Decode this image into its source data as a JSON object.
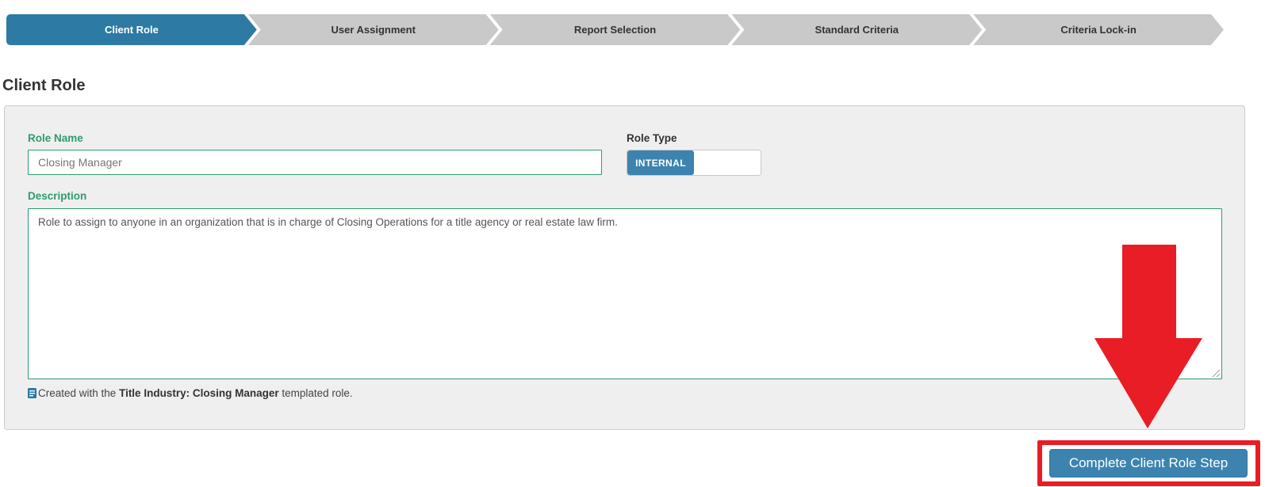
{
  "stepper": {
    "steps": [
      {
        "label": "Client Role",
        "active": true
      },
      {
        "label": "User Assignment",
        "active": false
      },
      {
        "label": "Report Selection",
        "active": false
      },
      {
        "label": "Standard Criteria",
        "active": false
      },
      {
        "label": "Criteria Lock-in",
        "active": false
      }
    ]
  },
  "page": {
    "title": "Client Role"
  },
  "form": {
    "role_name": {
      "label": "Role Name",
      "value": "Closing Manager"
    },
    "role_type": {
      "label": "Role Type",
      "selected": "INTERNAL"
    },
    "description": {
      "label": "Description",
      "value": "Role to assign to anyone in an organization that is in charge of Closing Operations for a title agency or real estate law firm."
    },
    "template_note": {
      "prefix": "Created with the ",
      "template_name": "Title Industry: Closing Manager",
      "suffix": " templated role."
    }
  },
  "actions": {
    "complete_button": "Complete Client Role Step"
  },
  "colors": {
    "stepper_active": "#2d7aa5",
    "stepper_inactive": "#c9c9c9",
    "accent_green": "#2e9c6d",
    "button_blue": "#3c84af",
    "annotation_red": "#e91d25",
    "panel_background": "#f0efef"
  }
}
